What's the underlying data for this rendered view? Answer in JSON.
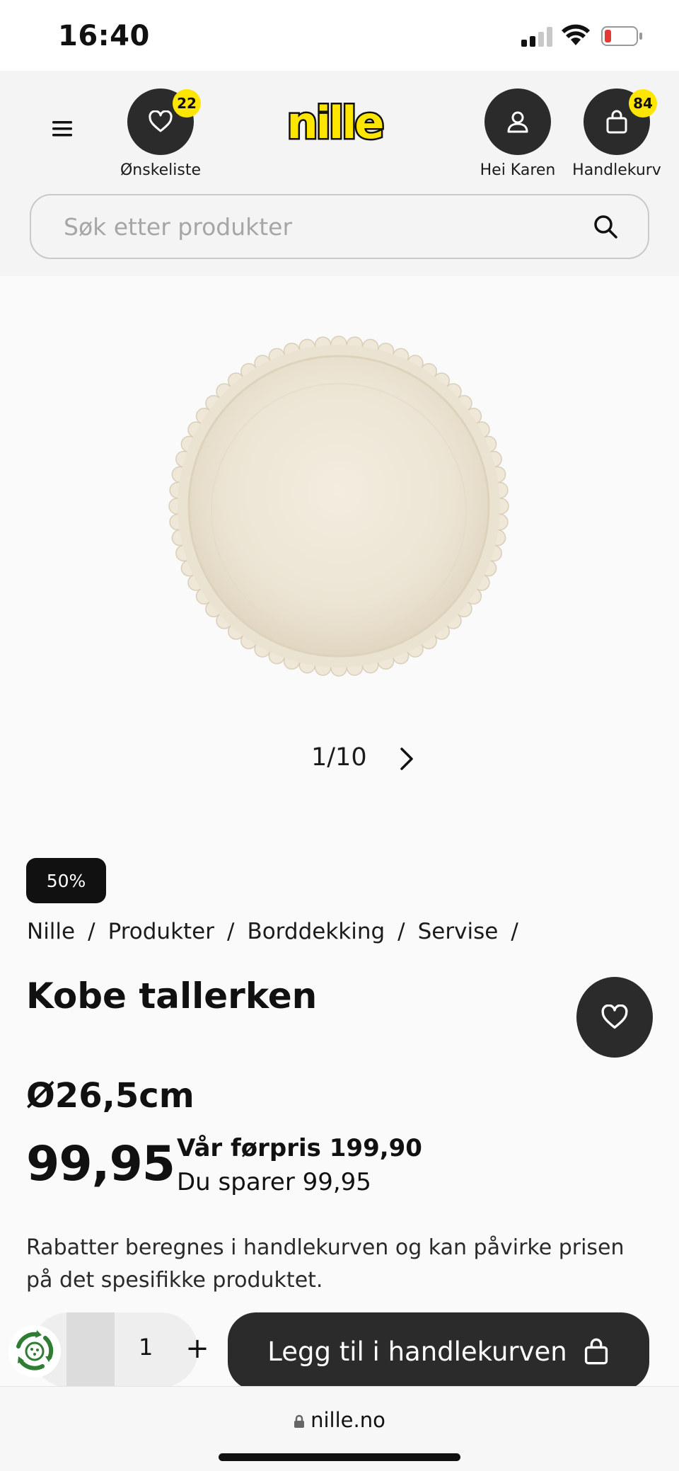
{
  "status_bar": {
    "time": "16:40"
  },
  "header": {
    "logo_text": "nille",
    "wishlist": {
      "label": "Ønskeliste",
      "count": "22"
    },
    "account": {
      "label": "Hei Karen"
    },
    "cart": {
      "label": "Handlekurv",
      "count": "84"
    },
    "search": {
      "placeholder": "Søk etter produkter"
    }
  },
  "gallery": {
    "pager": "1/10"
  },
  "product": {
    "discount_badge": "50%",
    "breadcrumb": [
      "Nille",
      "Produkter",
      "Borddekking",
      "Servise"
    ],
    "title": "Kobe tallerken",
    "size": "Ø26,5cm",
    "price": "99,95",
    "previous_price": "Vår førpris 199,90",
    "savings": "Du sparer 99,95",
    "discount_note": "Rabatter beregnes i handlekurven og kan påvirke prisen på det spesifikke produktet.",
    "quantity": "1",
    "add_to_cart_label": "Legg til i handlekurven"
  },
  "browser": {
    "url": "nille.no"
  },
  "colors": {
    "brand_yellow": "#ffe600",
    "dark": "#2b2b2b",
    "header_bg": "#f4f4f4"
  }
}
